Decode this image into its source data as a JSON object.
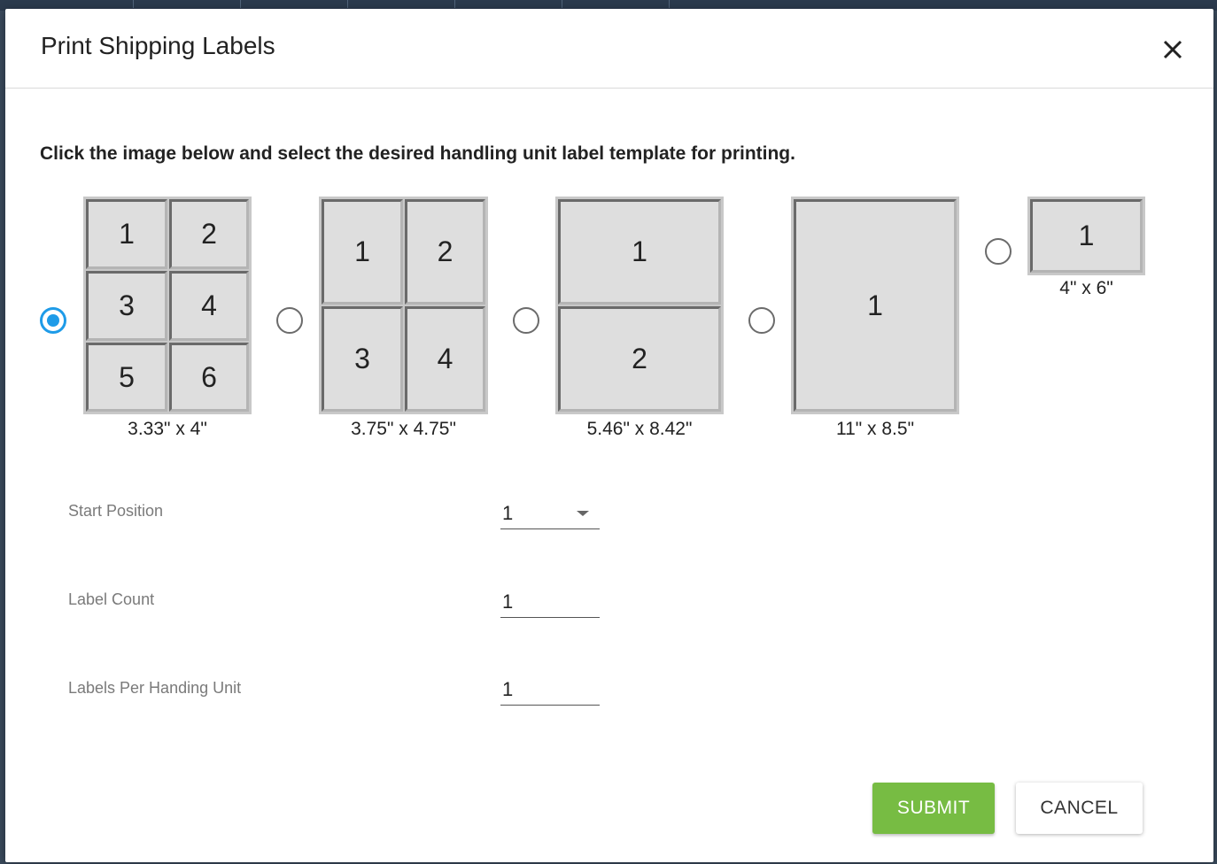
{
  "dialog": {
    "title": "Print Shipping Labels",
    "close_icon": "close-icon"
  },
  "instruction": "Click the image below and select the desired handling unit label template for printing.",
  "templates": [
    {
      "size": "3.33\" x 4\"",
      "selected": true,
      "cells": [
        "1",
        "2",
        "3",
        "4",
        "5",
        "6"
      ]
    },
    {
      "size": "3.75\" x 4.75\"",
      "selected": false,
      "cells": [
        "1",
        "2",
        "3",
        "4"
      ]
    },
    {
      "size": "5.46\" x 8.42\"",
      "selected": false,
      "cells": [
        "1",
        "2"
      ]
    },
    {
      "size": "11\" x 8.5\"",
      "selected": false,
      "cells": [
        "1"
      ]
    },
    {
      "size": "4\" x 6\"",
      "selected": false,
      "cells": [
        "1"
      ]
    }
  ],
  "form": {
    "start_position": {
      "label": "Start Position",
      "value": "1"
    },
    "label_count": {
      "label": "Label Count",
      "value": "1"
    },
    "labels_per_unit": {
      "label": "Labels Per Handing Unit",
      "value": "1"
    }
  },
  "buttons": {
    "submit": "SUBMIT",
    "cancel": "CANCEL"
  },
  "colors": {
    "accent": "#1e9be8",
    "submit": "#77bc43"
  }
}
